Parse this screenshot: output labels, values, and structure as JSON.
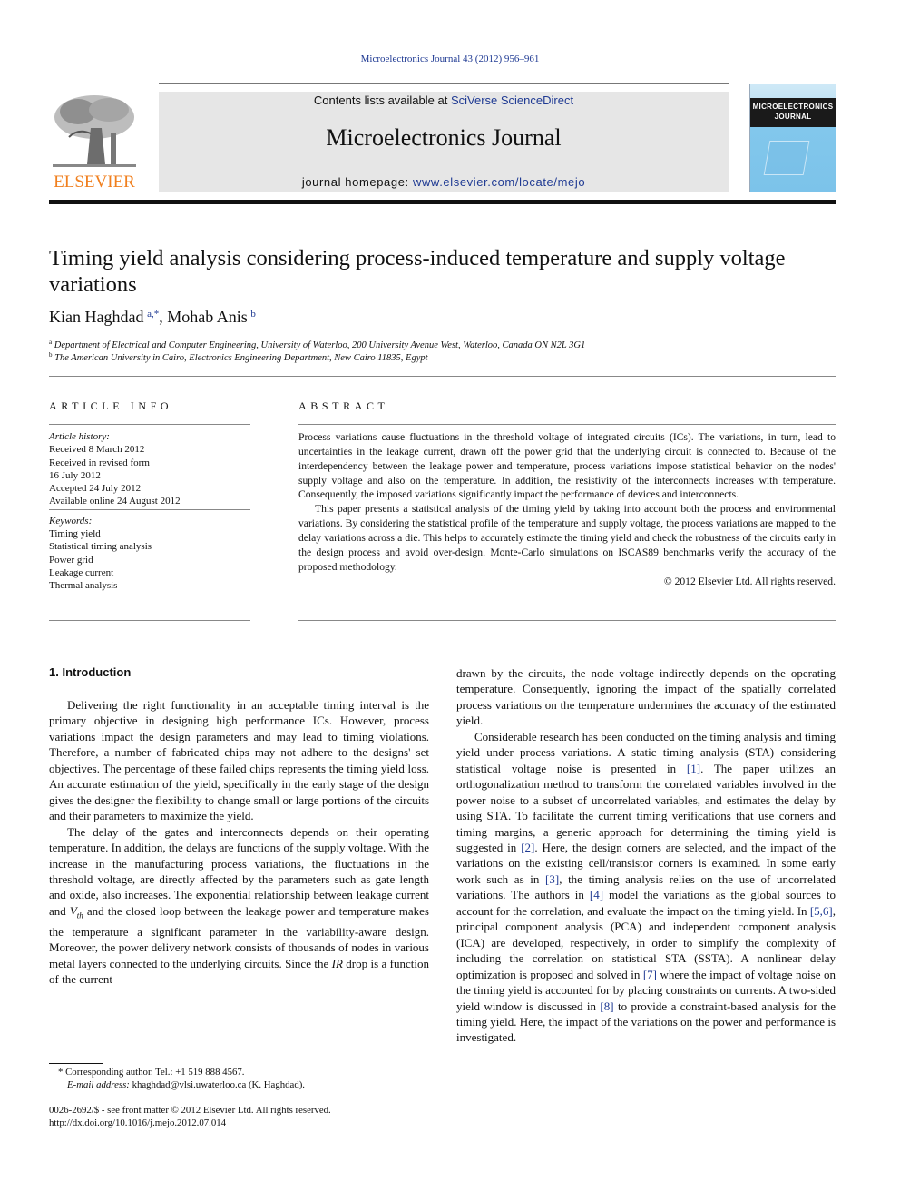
{
  "header": {
    "citation": "Microelectronics Journal 43 (2012) 956–961",
    "publisher_logo_text": "ELSEVIER",
    "contents_prefix": "Contents lists available at ",
    "contents_link": "SciVerse ScienceDirect",
    "journal_name": "Microelectronics Journal",
    "homepage_prefix": "journal homepage: ",
    "homepage_link": "www.elsevier.com/locate/mejo",
    "cover_title_line1": "MICROELECTRONICS",
    "cover_title_line2": "JOURNAL"
  },
  "article": {
    "title": "Timing yield analysis considering process-induced temperature and supply voltage variations",
    "authors": [
      {
        "name": "Kian Haghdad",
        "marks": "a,*"
      },
      {
        "name": "Mohab Anis",
        "marks": "b"
      }
    ],
    "author_separator": ", ",
    "affiliations": [
      {
        "mark": "a",
        "text": "Department of Electrical and Computer Engineering, University of Waterloo, 200 University Avenue West, Waterloo, Canada ON N2L 3G1"
      },
      {
        "mark": "b",
        "text": "The American University in Cairo, Electronics Engineering Department, New Cairo 11835, Egypt"
      }
    ]
  },
  "article_info": {
    "heading": "ARTICLE INFO",
    "history_label": "Article history:",
    "history": [
      "Received 8 March 2012",
      "Received in revised form",
      "16 July 2012",
      "Accepted 24 July 2012",
      "Available online 24 August 2012"
    ],
    "keywords_label": "Keywords:",
    "keywords": [
      "Timing yield",
      "Statistical timing analysis",
      "Power grid",
      "Leakage current",
      "Thermal analysis"
    ]
  },
  "abstract": {
    "heading": "ABSTRACT",
    "paragraphs": [
      "Process variations cause fluctuations in the threshold voltage of integrated circuits (ICs). The variations, in turn, lead to uncertainties in the leakage current, drawn off the power grid that the underlying circuit is connected to. Because of the interdependency between the leakage power and temperature, process variations impose statistical behavior on the nodes' supply voltage and also on the temperature. In addition, the resistivity of the interconnects increases with temperature. Consequently, the imposed variations significantly impact the performance of devices and interconnects.",
      "This paper presents a statistical analysis of the timing yield by taking into account both the process and environmental variations. By considering the statistical profile of the temperature and supply voltage, the process variations are mapped to the delay variations across a die. This helps to accurately estimate the timing yield and check the robustness of the circuits early in the design process and avoid over-design. Monte-Carlo simulations on ISCAS89 benchmarks verify the accuracy of the proposed methodology."
    ],
    "copyright": "© 2012 Elsevier Ltd. All rights reserved."
  },
  "body": {
    "section_heading": "1.  Introduction",
    "left_p1": "Delivering the right functionality in an acceptable timing interval is the primary objective in designing high performance ICs. However, process variations impact the design parameters and may lead to timing violations. Therefore, a number of fabricated chips may not adhere to the designs' set objectives. The percentage of these failed chips represents the timing yield loss. An accurate estimation of the yield, specifically in the early stage of the design gives the designer the flexibility to change small or large portions of the circuits and their parameters to maximize the yield.",
    "left_p2_a": "The delay of the gates and interconnects depends on their operating temperature. In addition, the delays are functions of the supply voltage. With the increase in the manufacturing process variations, the fluctuations in the threshold voltage, are directly affected by the parameters such as gate length and oxide, also increases. The exponential relationship between leakage current and ",
    "left_p2_vth": "V",
    "left_p2_vth_sub": "th",
    "left_p2_b": " and the closed loop between the leakage power and temperature makes the temperature a significant parameter in the variability-aware design. Moreover, the power delivery network consists of thousands of nodes in various metal layers connected to the underlying circuits. Since the ",
    "left_p2_ir": "IR",
    "left_p2_c": " drop is a function of the current",
    "right_p1": "drawn by the circuits, the node voltage indirectly depends on the operating temperature. Consequently, ignoring the impact of the spatially correlated process variations on the temperature undermines the accuracy of the estimated yield.",
    "right_p2": [
      {
        "t": "Considerable research has been conducted on the timing analysis and timing yield under process variations. A static timing analysis (STA) considering statistical voltage noise is presented in "
      },
      {
        "ref": "[1]"
      },
      {
        "t": ". The paper utilizes an orthogonalization method to transform the correlated variables involved in the power noise to a subset of uncorrelated variables, and estimates the delay by using STA. To facilitate the current timing verifications that use corners and timing margins, a generic approach for determining the timing yield is suggested in "
      },
      {
        "ref": "[2]"
      },
      {
        "t": ". Here, the design corners are selected, and the impact of the variations on the existing cell/transistor corners is examined. In some early work such as in "
      },
      {
        "ref": "[3]"
      },
      {
        "t": ", the timing analysis relies on the use of uncorrelated variations. The authors in "
      },
      {
        "ref": "[4]"
      },
      {
        "t": " model the variations as the global sources to account for the correlation, and evaluate the impact on the timing yield. In "
      },
      {
        "ref": "[5,6]"
      },
      {
        "t": ", principal component analysis (PCA) and independent component analysis (ICA) are developed, respectively, in order to simplify the complexity of including the correlation on statistical STA (SSTA). A nonlinear delay optimization is proposed and solved in "
      },
      {
        "ref": "[7]"
      },
      {
        "t": " where the impact of voltage noise on the timing yield is accounted for by placing constraints on currents. A two-sided yield window is discussed in "
      },
      {
        "ref": "[8]"
      },
      {
        "t": " to provide a constraint-based analysis for the timing yield. Here, the impact of the variations on the power and performance is investigated."
      }
    ]
  },
  "footnotes": {
    "corresponding": "* Corresponding author. Tel.: +1 519 888 4567.",
    "email_label": "E-mail address:",
    "email": " khaghdad@vlsi.uwaterloo.ca (K. Haghdad).",
    "front_matter": "0026-2692/$ - see front matter © 2012 Elsevier Ltd. All rights reserved.",
    "doi": "http://dx.doi.org/10.1016/j.mejo.2012.07.014"
  },
  "colors": {
    "link": "#1f3a93",
    "elsevier_orange": "#f07f1e",
    "banner_bg": "#e6e6e6"
  }
}
